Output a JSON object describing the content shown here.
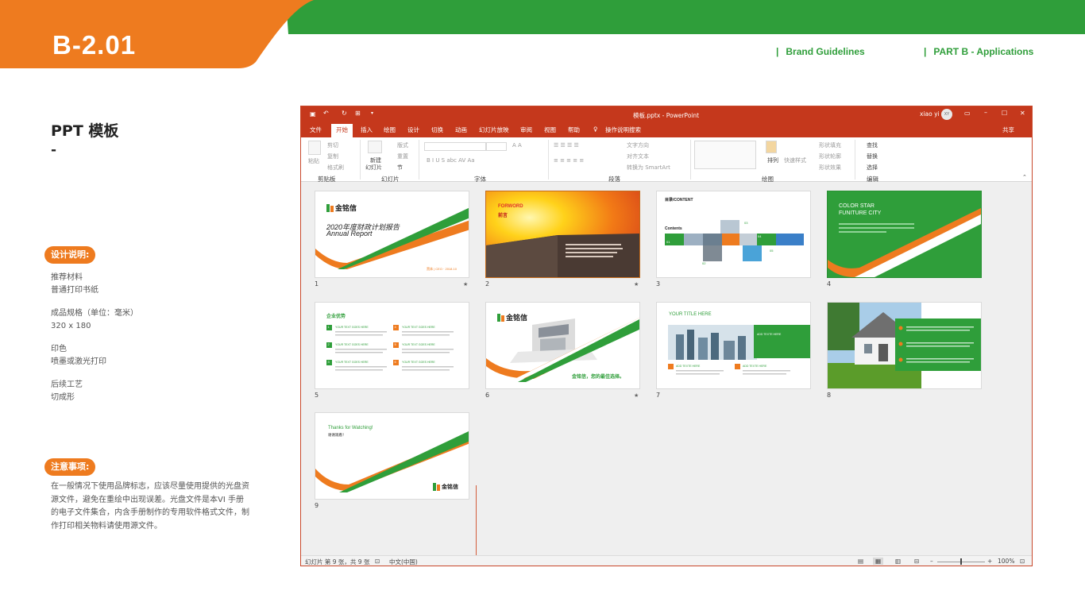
{
  "header": {
    "page_code": "B-2.01",
    "link_brand": "Brand Guidelines",
    "link_part": "PART B - Applications",
    "separator": "|",
    "colors": {
      "orange": "#ee7b1f",
      "green": "#2f9e3a"
    }
  },
  "section": {
    "title": "PPT 模板",
    "dash": "-"
  },
  "design": {
    "label": "设计说明:",
    "material_label": "推荐材料",
    "material_value": "普通打印书纸",
    "size_label": "成品规格（单位：毫米）",
    "size_value": "320 x 180",
    "print_label": "印色",
    "print_value": "喷墨或激光打印",
    "post_label": "后续工艺",
    "post_value": "切成形"
  },
  "notes": {
    "label": "注意事项:",
    "text": "在一般情况下使用品牌标志，应该尽量使用提供的光盘资源文件，避免在重绘中出现误差。光盘文件是本VI 手册的电子文件集合，内含手册制作的专用软件格式文件，制作打印相关物料请使用源文件。"
  },
  "ppt": {
    "filename": "模板.pptx - PowerPoint",
    "user": "xiao yi",
    "user_initials": "XY",
    "share": "共享",
    "tell_me": "操作说明搜索",
    "tabs": [
      "文件",
      "开始",
      "插入",
      "绘图",
      "设计",
      "切换",
      "动画",
      "幻灯片放映",
      "审阅",
      "视图",
      "帮助"
    ],
    "active_tab": "开始",
    "ribbon": {
      "paste": "粘贴",
      "cut": "剪切",
      "copy": "复制",
      "format_painter": "格式刷",
      "new_slide_1": "新建",
      "new_slide_2": "幻灯片",
      "layout": "版式",
      "reset": "重置",
      "section": "节",
      "text_direction": "文字方向",
      "align_text": "对齐文本",
      "smartart": "转换为 SmartArt",
      "arrange": "排列",
      "quick_styles": "快速样式",
      "shape_fill": "形状填充",
      "shape_outline": "形状轮廓",
      "shape_effects": "形状效果",
      "find": "查找",
      "replace": "替换",
      "select": "选择",
      "groups": [
        "剪贴板",
        "幻灯片",
        "字体",
        "段落",
        "绘图",
        "编辑"
      ]
    },
    "status": {
      "slide_info": "幻灯片 第 9 张，共 9 张",
      "language": "中文(中国)",
      "zoom": "100%"
    },
    "slide_numbers": [
      "1",
      "2",
      "3",
      "4",
      "5",
      "6",
      "7",
      "8",
      "9"
    ],
    "slides": {
      "s1": {
        "logo": "金铭信",
        "title": "2020年度财政计划报告",
        "subtitle": "Annual Report",
        "footer": "黑体 | CEO · 2018.10"
      },
      "s2": {
        "title": "FORWORD",
        "subtitle": "前言"
      },
      "s3": {
        "title": "目录/CONTENT",
        "contents": "Contents",
        "items": [
          "01",
          "02",
          "03",
          "04",
          "05"
        ]
      },
      "s4": {
        "title_1": "COLOR STAR",
        "title_2": "FUNITURE CITY"
      },
      "s5": {
        "title": "企业优势",
        "item": "YOUR TEXT GOES HERE",
        "nums": [
          "1",
          "2",
          "3",
          "4",
          "5",
          "6"
        ]
      },
      "s6": {
        "logo": "金铭信",
        "slogan": "金铭信，您的最佳选择。"
      },
      "s7": {
        "title": "YOUR TITLE HERE",
        "box": "ADD TEXTE HERE",
        "sub1": "ADD TEXTE HERE",
        "sub2": "ADD TEXTE HERE"
      },
      "s9": {
        "thanks": "Thanks for Watching!",
        "sub": "谢谢观看！",
        "logo": "金铭信"
      }
    }
  }
}
